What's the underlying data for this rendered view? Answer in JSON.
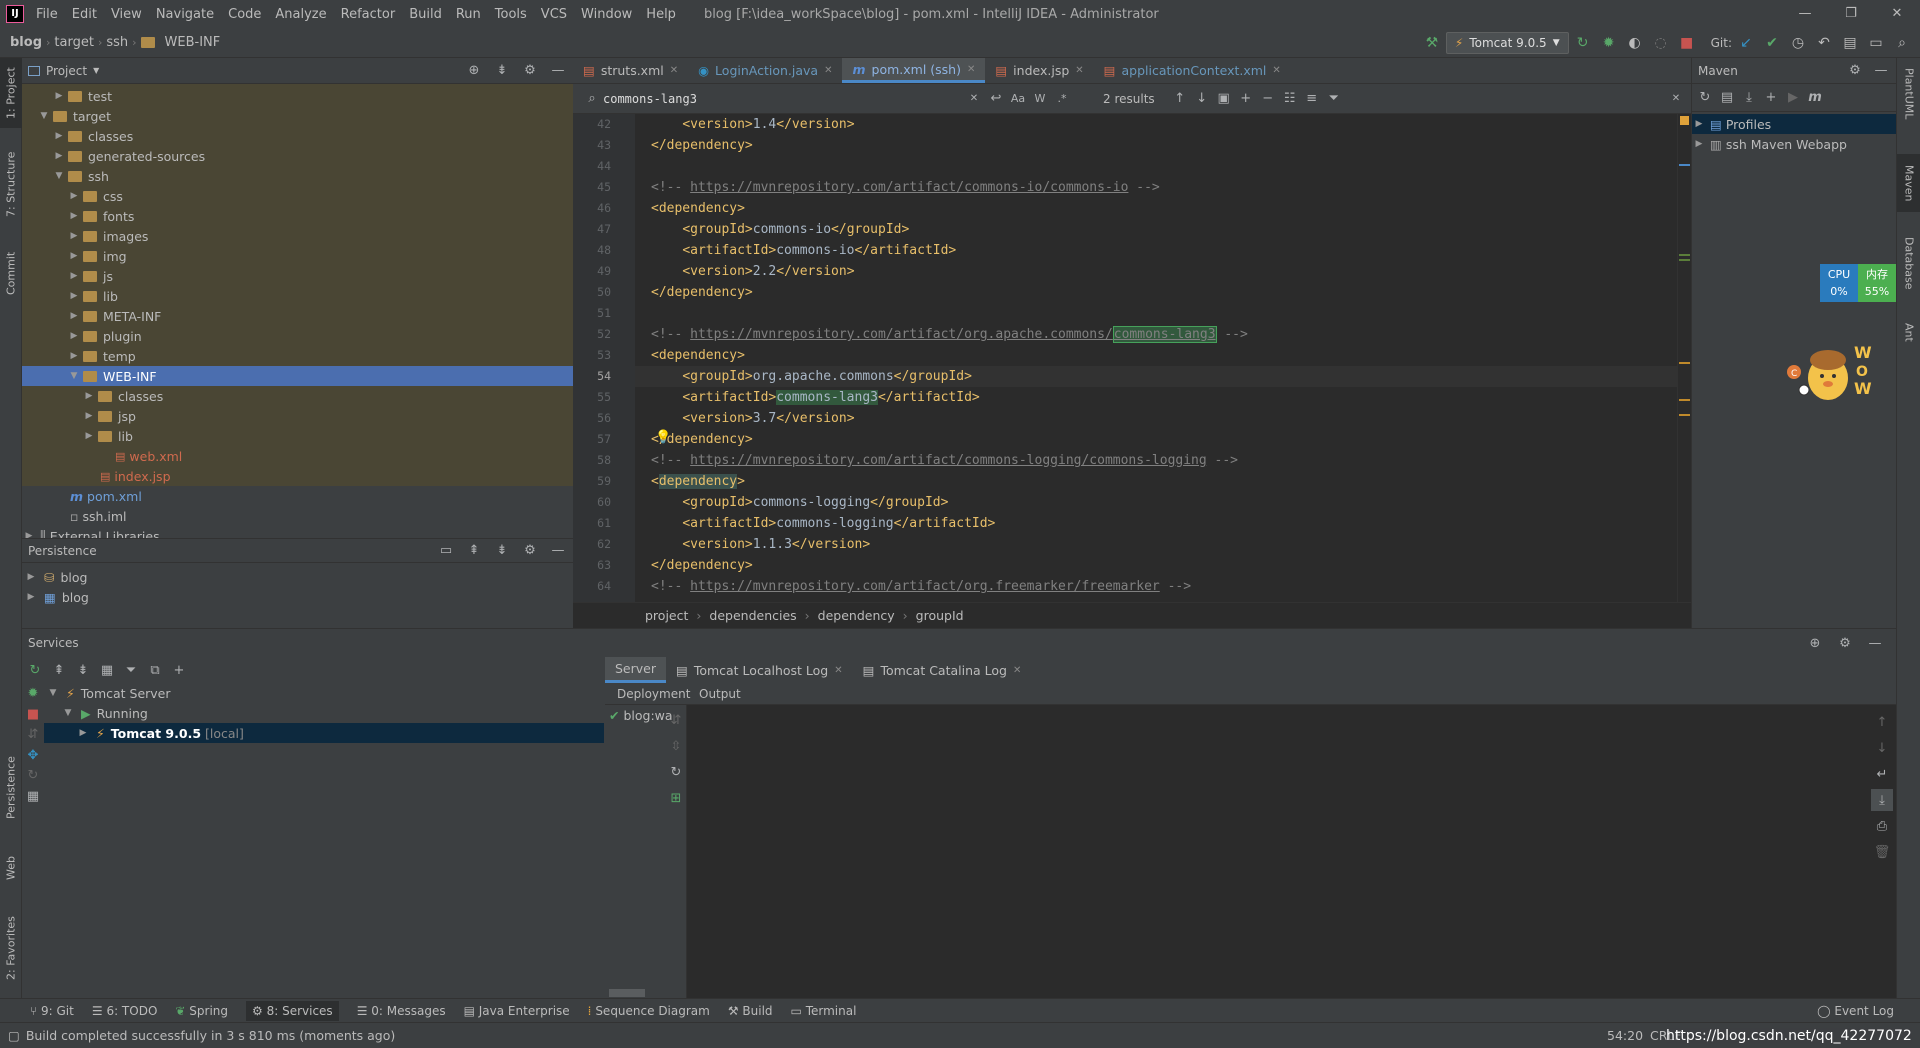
{
  "menu": [
    "File",
    "Edit",
    "View",
    "Navigate",
    "Code",
    "Analyze",
    "Refactor",
    "Build",
    "Run",
    "Tools",
    "VCS",
    "Window",
    "Help"
  ],
  "window_title": "blog [F:\\idea_workSpace\\blog] - pom.xml - IntelliJ IDEA - Administrator",
  "breadcrumbs": [
    "blog",
    "target",
    "ssh",
    "WEB-INF"
  ],
  "run_config": "Tomcat 9.0.5",
  "git_label": "Git:",
  "left_stripe": [
    "1: Project",
    "7: Structure",
    "Commit",
    "Persistence",
    "Web",
    "2: Favorites"
  ],
  "right_stripe": [
    "PlantUML",
    "Maven",
    "Database",
    "Ant"
  ],
  "project": {
    "title": "Project",
    "tree": [
      {
        "label": "test",
        "indent": 2,
        "type": "folder",
        "arrow": "▶"
      },
      {
        "label": "target",
        "indent": 1,
        "type": "folder",
        "arrow": "▼"
      },
      {
        "label": "classes",
        "indent": 2,
        "type": "folder",
        "arrow": "▶"
      },
      {
        "label": "generated-sources",
        "indent": 2,
        "type": "folder",
        "arrow": "▶"
      },
      {
        "label": "ssh",
        "indent": 2,
        "type": "folder",
        "arrow": "▼"
      },
      {
        "label": "css",
        "indent": 3,
        "type": "folder",
        "arrow": "▶"
      },
      {
        "label": "fonts",
        "indent": 3,
        "type": "folder",
        "arrow": "▶"
      },
      {
        "label": "images",
        "indent": 3,
        "type": "folder",
        "arrow": "▶"
      },
      {
        "label": "img",
        "indent": 3,
        "type": "folder",
        "arrow": "▶"
      },
      {
        "label": "js",
        "indent": 3,
        "type": "folder",
        "arrow": "▶"
      },
      {
        "label": "lib",
        "indent": 3,
        "type": "folder",
        "arrow": "▶"
      },
      {
        "label": "META-INF",
        "indent": 3,
        "type": "folder",
        "arrow": "▶"
      },
      {
        "label": "plugin",
        "indent": 3,
        "type": "folder",
        "arrow": "▶"
      },
      {
        "label": "temp",
        "indent": 3,
        "type": "folder",
        "arrow": "▶"
      },
      {
        "label": "WEB-INF",
        "indent": 3,
        "type": "folder",
        "arrow": "▼",
        "selected": true
      },
      {
        "label": "classes",
        "indent": 4,
        "type": "folder",
        "arrow": "▶"
      },
      {
        "label": "jsp",
        "indent": 4,
        "type": "folder",
        "arrow": "▶"
      },
      {
        "label": "lib",
        "indent": 4,
        "type": "folder",
        "arrow": "▶"
      },
      {
        "label": "web.xml",
        "indent": 5,
        "type": "xml",
        "arrow": ""
      },
      {
        "label": "index.jsp",
        "indent": 4,
        "type": "xml",
        "arrow": ""
      },
      {
        "label": "pom.xml",
        "indent": 2,
        "type": "maven",
        "arrow": ""
      },
      {
        "label": "ssh.iml",
        "indent": 2,
        "type": "file",
        "arrow": ""
      },
      {
        "label": "External Libraries",
        "indent": 0,
        "type": "lib",
        "arrow": "▶"
      }
    ]
  },
  "persistence": {
    "title": "Persistence",
    "items": [
      "blog",
      "blog"
    ]
  },
  "editor": {
    "tabs": [
      {
        "label": "struts.xml",
        "active": false
      },
      {
        "label": "LoginAction.java",
        "active": false
      },
      {
        "label": "pom.xml (ssh)",
        "active": true
      },
      {
        "label": "index.jsp",
        "active": false
      },
      {
        "label": "applicationContext.xml",
        "active": false
      }
    ],
    "search_value": "commons-lang3",
    "search_results": "2 results",
    "lines": [
      {
        "n": "42",
        "html": "    <span class='tag'>&lt;version&gt;</span>1.4<span class='tag'>&lt;/version&gt;</span>"
      },
      {
        "n": "43",
        "html": "<span class='tag'>&lt;/dependency&gt;</span>"
      },
      {
        "n": "44",
        "html": ""
      },
      {
        "n": "45",
        "html": "<span class='cmt'>&lt;!-- </span><span class='url'>https://mvnrepository.com/artifact/commons-io/commons-io</span><span class='cmt'> --&gt;</span>"
      },
      {
        "n": "46",
        "html": "<span class='tag'>&lt;dependency&gt;</span>"
      },
      {
        "n": "47",
        "html": "    <span class='tag'>&lt;groupId&gt;</span>commons-io<span class='tag'>&lt;/groupId&gt;</span>"
      },
      {
        "n": "48",
        "html": "    <span class='tag'>&lt;artifactId&gt;</span>commons-io<span class='tag'>&lt;/artifactId&gt;</span>"
      },
      {
        "n": "49",
        "html": "    <span class='tag'>&lt;version&gt;</span>2.2<span class='tag'>&lt;/version&gt;</span>"
      },
      {
        "n": "50",
        "html": "<span class='tag'>&lt;/dependency&gt;</span>"
      },
      {
        "n": "51",
        "html": ""
      },
      {
        "n": "52",
        "html": "<span class='cmt'>&lt;!-- </span><span class='url'>https://mvnrepository.com/artifact/org.apache.commons/</span><span class='url hl hlbox'>commons-lang3</span><span class='cmt'> --&gt;</span>"
      },
      {
        "n": "53",
        "html": "<span class='tag'>&lt;dependency&gt;</span>"
      },
      {
        "n": "54",
        "html": "    <span class='tag'>&lt;groupId&gt;</span>org.apache.commons<span class='tag'>&lt;/groupId&gt;</span>",
        "cur": true
      },
      {
        "n": "55",
        "html": "    <span class='tag'>&lt;artifactId&gt;</span><span class='hl'>commons-lang3</span><span class='tag'>&lt;/artifactId&gt;</span>"
      },
      {
        "n": "56",
        "html": "    <span class='tag'>&lt;version&gt;</span>3.7<span class='tag'>&lt;/version&gt;</span>"
      },
      {
        "n": "57",
        "html": "<span class='tag'>&lt;/dependency&gt;</span>"
      },
      {
        "n": "58",
        "html": "<span class='cmt'>&lt;!-- </span><span class='url'>https://mvnrepository.com/artifact/commons-logging/commons-logging</span><span class='cmt'> --&gt;</span>"
      },
      {
        "n": "59",
        "html": "<span class='tag'>&lt;</span><span class='tag dephl'>dependency</span><span class='tag'>&gt;</span>"
      },
      {
        "n": "60",
        "html": "    <span class='tag'>&lt;groupId&gt;</span>commons-logging<span class='tag'>&lt;/groupId&gt;</span>"
      },
      {
        "n": "61",
        "html": "    <span class='tag'>&lt;artifactId&gt;</span>commons-logging<span class='tag'>&lt;/artifactId&gt;</span>"
      },
      {
        "n": "62",
        "html": "    <span class='tag'>&lt;version&gt;</span>1.1.3<span class='tag'>&lt;/version&gt;</span>"
      },
      {
        "n": "63",
        "html": "<span class='tag'>&lt;/dependency&gt;</span>"
      },
      {
        "n": "64",
        "html": "<span class='cmt'>&lt;!-- </span><span class='url'>https://mvnrepository.com/artifact/org.freemarker/freemarker</span><span class='cmt'> --&gt;</span>"
      }
    ],
    "breadcrumbs": [
      "project",
      "dependencies",
      "dependency",
      "groupId"
    ]
  },
  "maven": {
    "title": "Maven",
    "items": [
      "Profiles",
      "ssh Maven Webapp"
    ]
  },
  "monitor": {
    "cpu_label": "CPU",
    "cpu_value": "0%",
    "mem_label": "内存",
    "mem_value": "55%"
  },
  "services": {
    "title": "Services",
    "tree": [
      {
        "label": "Tomcat Server",
        "indent": 0,
        "arrow": "▼"
      },
      {
        "label": "Running",
        "indent": 1,
        "arrow": "▼"
      },
      {
        "label": "Tomcat 9.0.5",
        "suffix": "[local]",
        "indent": 2,
        "arrow": "▶",
        "selected": true
      }
    ],
    "tabs": [
      "Server",
      "Tomcat Localhost Log",
      "Tomcat Catalina Log"
    ],
    "subtabs": [
      "Deployment",
      "Output"
    ],
    "deployment_item": "blog:war"
  },
  "bottom_tools": [
    "9: Git",
    "6: TODO",
    "Spring",
    "8: Services",
    "0: Messages",
    "Java Enterprise",
    "Sequence Diagram",
    "Build",
    "Terminal"
  ],
  "event_log": "Event Log",
  "status": {
    "message": "Build completed successfully in 3 s 810 ms (moments ago)",
    "position": "54:20",
    "crlf": "CRLF",
    "watermark": "https://blog.csdn.net/qq_42277072"
  }
}
